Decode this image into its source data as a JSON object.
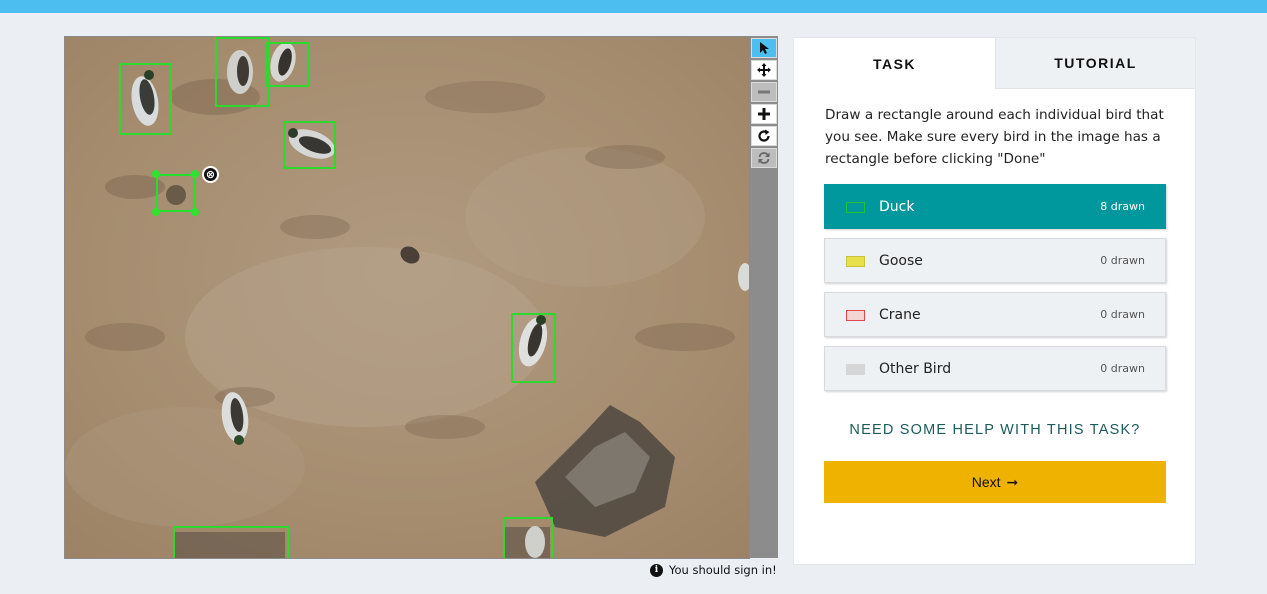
{
  "viewer": {
    "delete_glyph": "⊗"
  },
  "tools": [
    {
      "icon": "pointer-icon",
      "state": "active"
    },
    {
      "icon": "move-icon",
      "state": "normal"
    },
    {
      "icon": "zoom-out-icon",
      "state": "disabled"
    },
    {
      "icon": "zoom-in-icon",
      "state": "normal"
    },
    {
      "icon": "rotate-icon",
      "state": "normal"
    },
    {
      "icon": "reset-icon",
      "state": "disabled"
    }
  ],
  "signin_notice": "You should sign in!",
  "tabs": {
    "task": "TASK",
    "tutorial": "TUTORIAL"
  },
  "instruction": "Draw a rectangle around each individual bird that you see. Make sure every bird in the image has a rectangle before clicking \"Done\"",
  "answers": [
    {
      "label": "Duck",
      "count": "8 drawn",
      "selected": true,
      "swatch_color": "#22c22c"
    },
    {
      "label": "Goose",
      "count": "0 drawn",
      "selected": false,
      "swatch_color": "#e8e04a"
    },
    {
      "label": "Crane",
      "count": "0 drawn",
      "selected": false,
      "swatch_color": "#e0484c"
    },
    {
      "label": "Other Bird",
      "count": "0 drawn",
      "selected": false,
      "swatch_color": "#d4d6d8"
    }
  ],
  "help_link": "NEED SOME HELP WITH THIS TASK?",
  "next_button": {
    "label": "Next",
    "arrow": "➞"
  },
  "colors": {
    "topbar": "#4cbef0",
    "selected_answer": "#00979d",
    "next_button": "#f0b200",
    "box_stroke": "#2ed82e"
  }
}
